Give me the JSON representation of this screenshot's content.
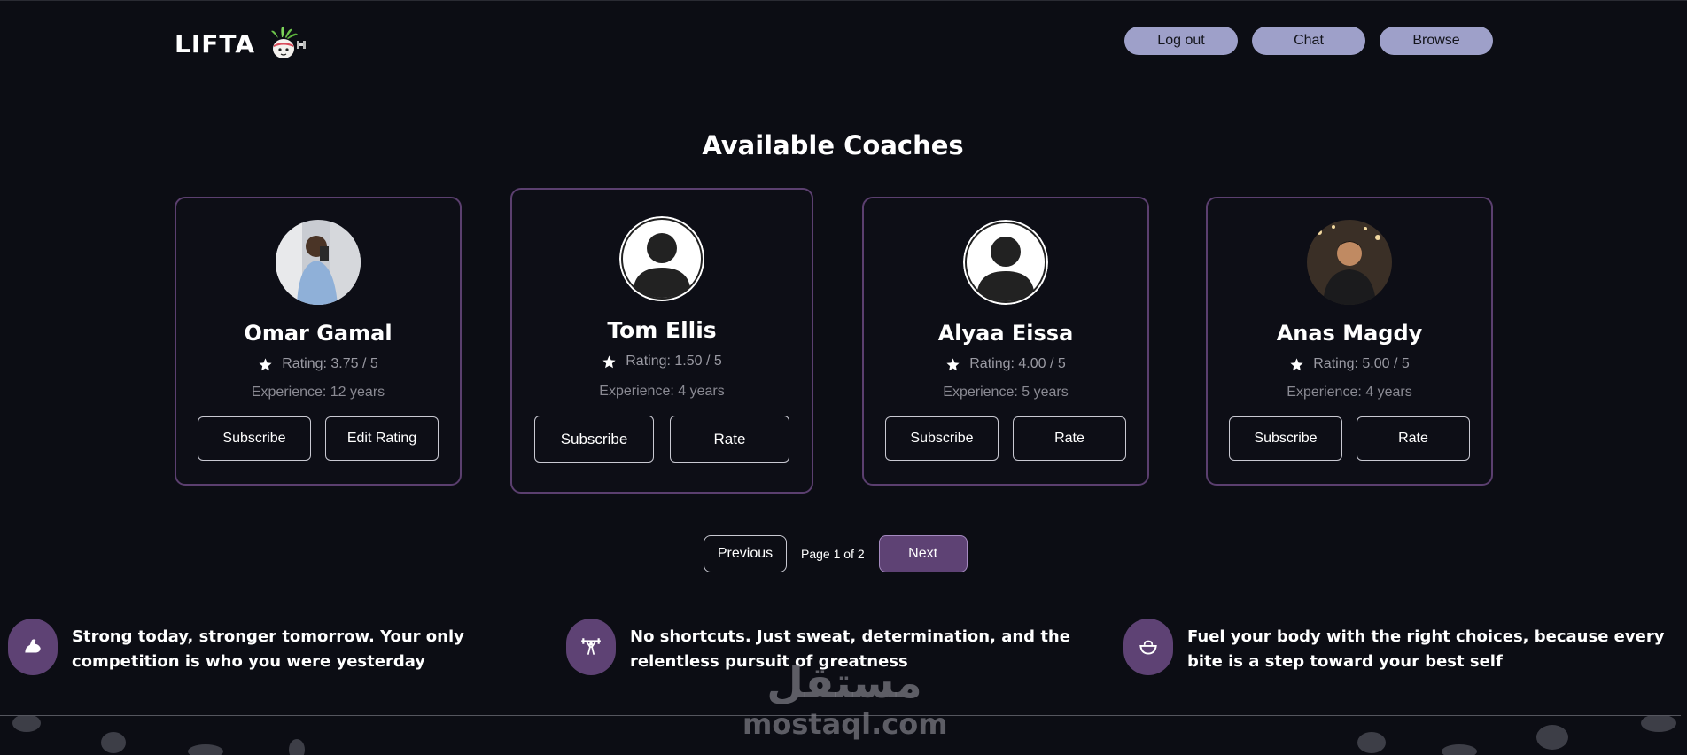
{
  "header": {
    "logo_text": "LIFTA",
    "logo_icon": "radish-mascot-icon",
    "nav": {
      "logout_label": "Log out",
      "chat_label": "Chat",
      "browse_label": "Browse"
    }
  },
  "main": {
    "title": "Available Coaches",
    "coaches": [
      {
        "name": "Omar Gamal",
        "avatar": "photo",
        "rating_text": "Rating: 3.75 / 5",
        "experience_text": "Experience: 12 years",
        "primary_label": "Subscribe",
        "secondary_label": "Edit Rating"
      },
      {
        "name": "Tom Ellis",
        "avatar": "default-user-icon",
        "rating_text": "Rating: 1.50 / 5",
        "experience_text": "Experience: 4 years",
        "primary_label": "Subscribe",
        "secondary_label": "Rate"
      },
      {
        "name": "Alyaa Eissa",
        "avatar": "default-user-icon",
        "rating_text": "Rating: 4.00 / 5",
        "experience_text": "Experience: 5 years",
        "primary_label": "Subscribe",
        "secondary_label": "Rate"
      },
      {
        "name": "Anas Magdy",
        "avatar": "photo",
        "rating_text": "Rating: 5.00 / 5",
        "experience_text": "Experience: 4 years",
        "primary_label": "Subscribe",
        "secondary_label": "Rate"
      }
    ],
    "pagination": {
      "previous_label": "Previous",
      "info": "Page 1 of 2",
      "next_label": "Next"
    }
  },
  "quotes": [
    {
      "icon": "flexed-arm-icon",
      "text": "Strong today, stronger tomorrow. Your only competition is who you were yesterday"
    },
    {
      "icon": "weightlifter-icon",
      "text": "No shortcuts. Just sweat, determination, and the relentless pursuit of greatness"
    },
    {
      "icon": "food-bowl-icon",
      "text": "Fuel your body with the right choices, because every bite is a step toward your best self"
    }
  ],
  "watermark": {
    "arabic": "مستقل",
    "latin": "mostaql.com"
  },
  "colors": {
    "background": "#0c0d14",
    "nav_button": "#9ea0c9",
    "card_border": "#5b3f6f",
    "accent_purple": "#5e4274",
    "muted_text": "#9a9aa3"
  }
}
